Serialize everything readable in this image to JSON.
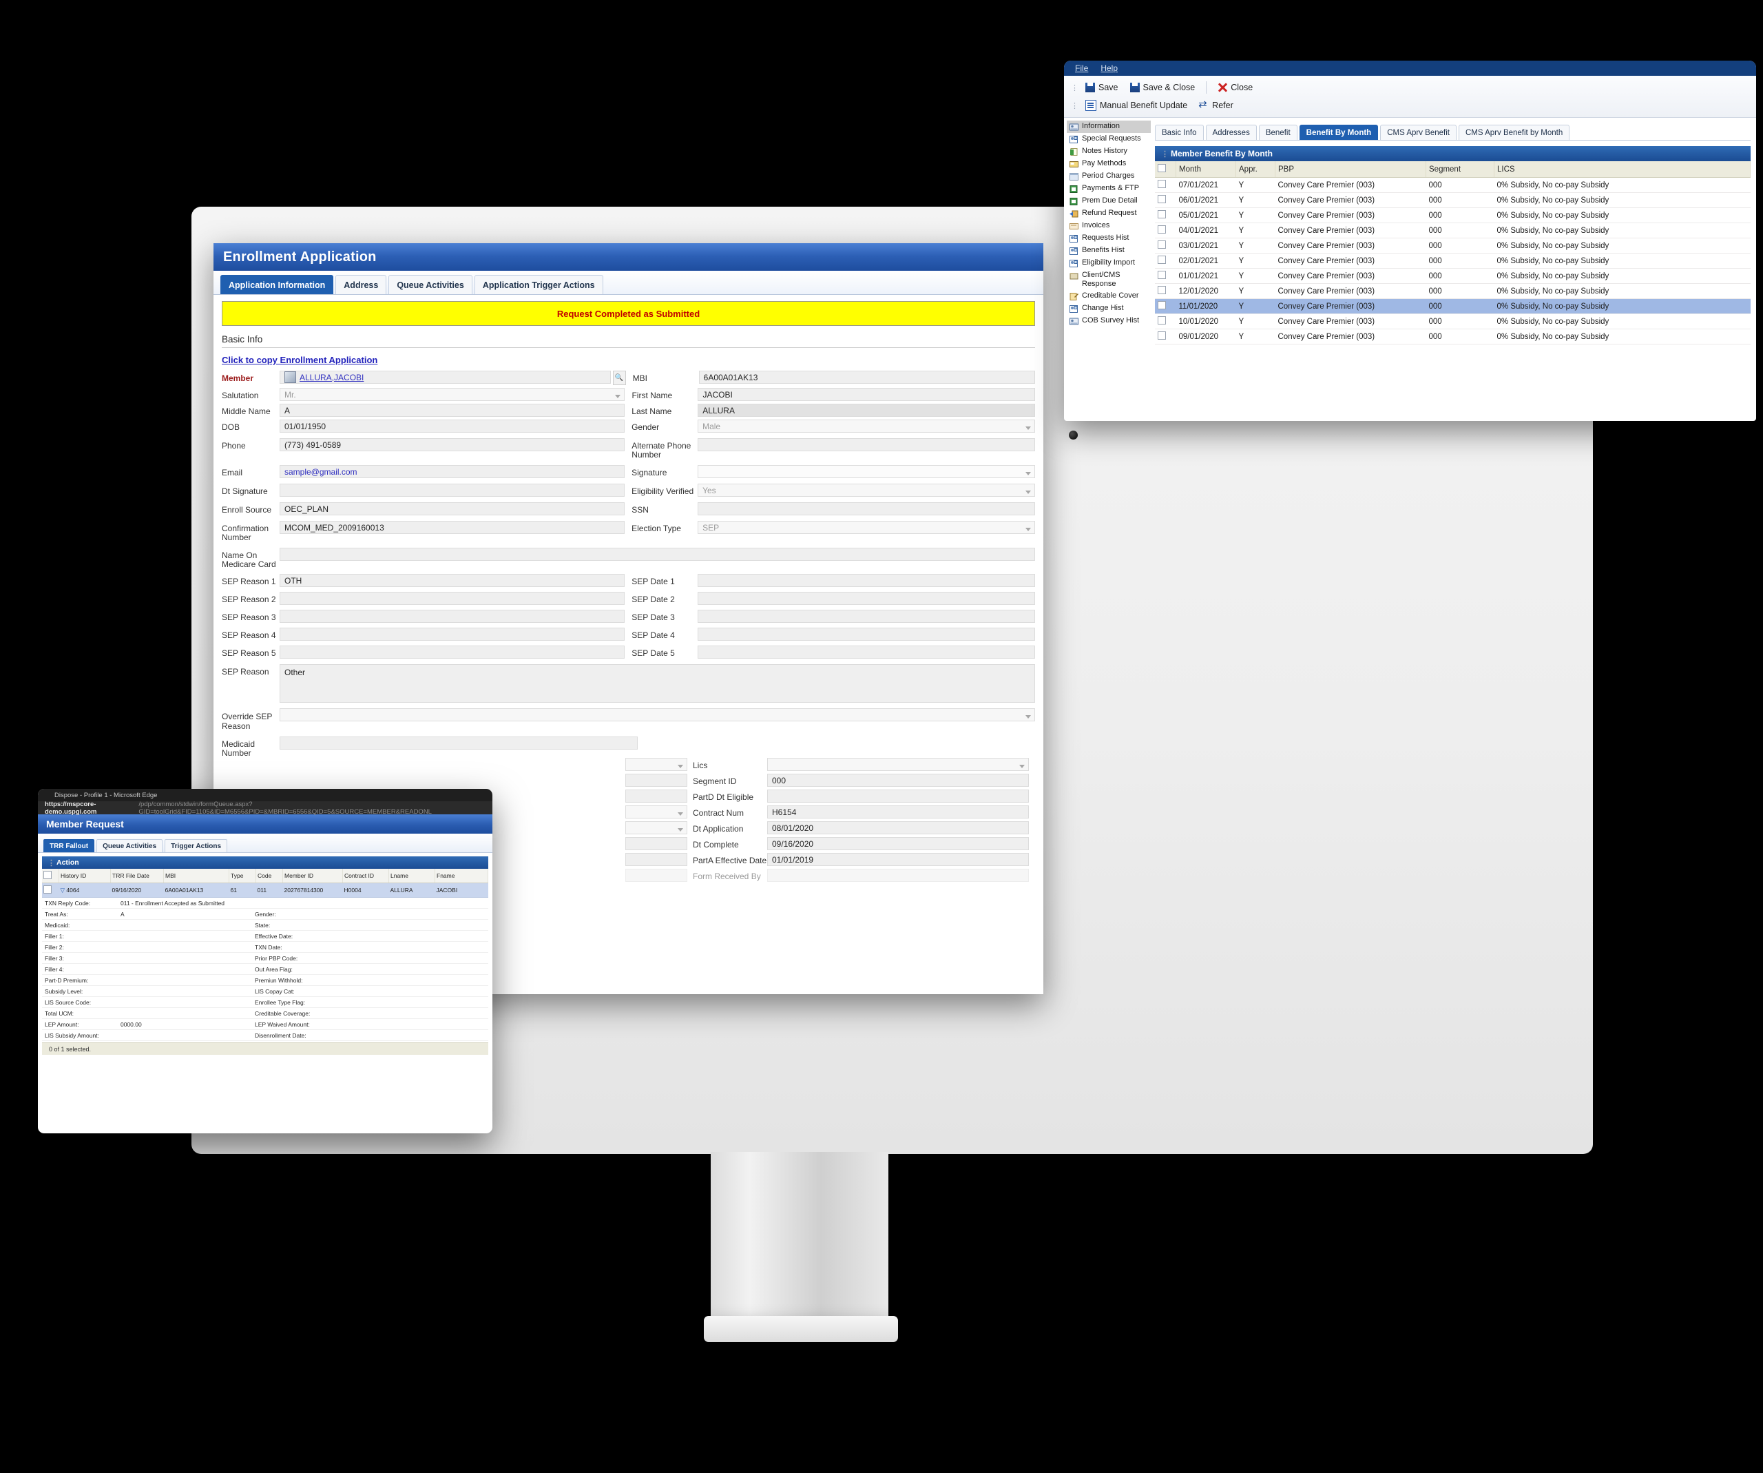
{
  "monitor": {
    "webcam": "webcam-dot"
  },
  "enrollment": {
    "title": "Enrollment Application",
    "tabs": [
      {
        "label": "Application Information",
        "active": true
      },
      {
        "label": "Address",
        "active": false
      },
      {
        "label": "Queue Activities",
        "active": false
      },
      {
        "label": "Application Trigger Actions",
        "active": false
      }
    ],
    "alert": "Request Completed as Submitted",
    "section": "Basic Info",
    "copy_link": "Click to copy Enrollment Application",
    "left_fields": [
      {
        "label": "Member",
        "value": "ALLURA,JACOBI",
        "type": "link",
        "required": true
      },
      {
        "label": "Salutation",
        "value": "Mr.",
        "type": "select-placeholder"
      },
      {
        "label": "Middle Name",
        "value": "A",
        "type": "text"
      },
      {
        "label": "DOB",
        "value": "01/01/1950",
        "type": "text"
      },
      {
        "label": "Phone",
        "value": "(773) 491-0589",
        "type": "text"
      },
      {
        "label": "Email",
        "value": "sample@gmail.com",
        "type": "email"
      },
      {
        "label": "Dt Signature",
        "value": "",
        "type": "text"
      },
      {
        "label": "Enroll Source",
        "value": "OEC_PLAN",
        "type": "text"
      },
      {
        "label": "Confirmation Number",
        "value": "MCOM_MED_2009160013",
        "type": "text"
      }
    ],
    "right_fields": [
      {
        "label": "MBI",
        "value": "6A00A01AK13",
        "type": "text"
      },
      {
        "label": "First Name",
        "value": "JACOBI",
        "type": "text"
      },
      {
        "label": "Last Name",
        "value": "ALLURA",
        "type": "text"
      },
      {
        "label": "Gender",
        "value": "Male",
        "type": "select-placeholder"
      },
      {
        "label": "Alternate Phone Number",
        "value": "",
        "type": "text"
      },
      {
        "label": "Signature",
        "value": "",
        "type": "select"
      },
      {
        "label": "Eligibility Verified",
        "value": "Yes",
        "type": "select-placeholder"
      },
      {
        "label": "SSN",
        "value": "",
        "type": "text"
      },
      {
        "label": "Election Type",
        "value": "SEP",
        "type": "select-placeholder"
      }
    ],
    "name_on_card": {
      "label": "Name On Medicare Card",
      "value": ""
    },
    "sep_rows": [
      {
        "label": "SEP Reason 1",
        "value": "OTH",
        "rlabel": "SEP Date 1",
        "rvalue": ""
      },
      {
        "label": "SEP Reason 2",
        "value": "",
        "rlabel": "SEP Date 2",
        "rvalue": ""
      },
      {
        "label": "SEP Reason 3",
        "value": "",
        "rlabel": "SEP Date 3",
        "rvalue": ""
      },
      {
        "label": "SEP Reason 4",
        "value": "",
        "rlabel": "SEP Date 4",
        "rvalue": ""
      },
      {
        "label": "SEP Reason 5",
        "value": "",
        "rlabel": "SEP Date 5",
        "rvalue": ""
      }
    ],
    "sep_reason": {
      "label": "SEP Reason",
      "value": "Other"
    },
    "override_sep": {
      "label": "Override SEP Reason",
      "value": ""
    },
    "medicaid_number": {
      "label": "Medicaid Number",
      "value": ""
    },
    "lower_right_fields": [
      {
        "label": "Lics",
        "value": "",
        "type": "select"
      },
      {
        "label": "Segment ID",
        "value": "000",
        "type": "text"
      },
      {
        "label": "PartD Dt Eligible",
        "value": "",
        "type": "text"
      },
      {
        "label": "Contract Num",
        "value": "H6154",
        "type": "text"
      },
      {
        "label": "Dt Application",
        "value": "08/01/2020",
        "type": "text"
      },
      {
        "label": "Dt Complete",
        "value": "09/16/2020",
        "type": "text"
      },
      {
        "label": "PartA Effective Date",
        "value": "01/01/2019",
        "type": "text"
      },
      {
        "label": "Form Received By",
        "value": "",
        "type": "text"
      }
    ]
  },
  "benefit_window": {
    "menu": [
      "File",
      "Help"
    ],
    "toolbar_row1": [
      {
        "label": "Save",
        "icon": "save-icon"
      },
      {
        "label": "Save & Close",
        "icon": "save-close-icon"
      },
      {
        "label": "Close",
        "icon": "close-icon"
      }
    ],
    "toolbar_row2": [
      {
        "label": "Manual Benefit Update",
        "icon": "manual-benefit-update-icon"
      },
      {
        "label": "Refer",
        "icon": "refer-icon"
      }
    ],
    "sidebar": [
      {
        "label": "Information",
        "active": true
      },
      {
        "label": "Special Requests",
        "active": false
      },
      {
        "label": "Notes History",
        "active": false
      },
      {
        "label": "Pay Methods",
        "active": false
      },
      {
        "label": "Period Charges",
        "active": false
      },
      {
        "label": "Payments & FTP",
        "active": false
      },
      {
        "label": "Prem Due Detail",
        "active": false
      },
      {
        "label": "Refund Request",
        "active": false
      },
      {
        "label": "Invoices",
        "active": false
      },
      {
        "label": "Requests Hist",
        "active": false
      },
      {
        "label": "Benefits Hist",
        "active": false
      },
      {
        "label": "Eligibility Import",
        "active": false
      },
      {
        "label": "Client/CMS Response",
        "active": false
      },
      {
        "label": "Creditable Cover",
        "active": false
      },
      {
        "label": "Change Hist",
        "active": false
      },
      {
        "label": "COB Survey Hist",
        "active": false
      }
    ],
    "tabs": [
      {
        "label": "Basic Info",
        "active": false
      },
      {
        "label": "Addresses",
        "active": false
      },
      {
        "label": "Benefit",
        "active": false
      },
      {
        "label": "Benefit By Month",
        "active": true
      },
      {
        "label": "CMS Aprv Benefit",
        "active": false
      },
      {
        "label": "CMS Aprv Benefit by Month",
        "active": false
      }
    ],
    "grid_title": "Member Benefit By Month",
    "columns": [
      "Month",
      "Appr.",
      "PBP",
      "Segment",
      "LICS"
    ],
    "rows": [
      {
        "month": "07/01/2021",
        "appr": "Y",
        "pbp": "Convey Care Premier (003)",
        "segment": "000",
        "lics": "0% Subsidy, No co-pay Subsidy",
        "selected": false
      },
      {
        "month": "06/01/2021",
        "appr": "Y",
        "pbp": "Convey Care Premier (003)",
        "segment": "000",
        "lics": "0% Subsidy, No co-pay Subsidy",
        "selected": false
      },
      {
        "month": "05/01/2021",
        "appr": "Y",
        "pbp": "Convey Care Premier (003)",
        "segment": "000",
        "lics": "0% Subsidy, No co-pay Subsidy",
        "selected": false
      },
      {
        "month": "04/01/2021",
        "appr": "Y",
        "pbp": "Convey Care Premier (003)",
        "segment": "000",
        "lics": "0% Subsidy, No co-pay Subsidy",
        "selected": false
      },
      {
        "month": "03/01/2021",
        "appr": "Y",
        "pbp": "Convey Care Premier (003)",
        "segment": "000",
        "lics": "0% Subsidy, No co-pay Subsidy",
        "selected": false
      },
      {
        "month": "02/01/2021",
        "appr": "Y",
        "pbp": "Convey Care Premier (003)",
        "segment": "000",
        "lics": "0% Subsidy, No co-pay Subsidy",
        "selected": false
      },
      {
        "month": "01/01/2021",
        "appr": "Y",
        "pbp": "Convey Care Premier (003)",
        "segment": "000",
        "lics": "0% Subsidy, No co-pay Subsidy",
        "selected": false
      },
      {
        "month": "12/01/2020",
        "appr": "Y",
        "pbp": "Convey Care Premier (003)",
        "segment": "000",
        "lics": "0% Subsidy, No co-pay Subsidy",
        "selected": false
      },
      {
        "month": "11/01/2020",
        "appr": "Y",
        "pbp": "Convey Care Premier (003)",
        "segment": "000",
        "lics": "0% Subsidy, No co-pay Subsidy",
        "selected": true
      },
      {
        "month": "10/01/2020",
        "appr": "Y",
        "pbp": "Convey Care Premier (003)",
        "segment": "000",
        "lics": "0% Subsidy, No co-pay Subsidy",
        "selected": false
      },
      {
        "month": "09/01/2020",
        "appr": "Y",
        "pbp": "Convey Care Premier (003)",
        "segment": "000",
        "lics": "0% Subsidy, No co-pay Subsidy",
        "selected": false
      }
    ]
  },
  "member_request": {
    "browser_title": "Dispose - Profile 1 - Microsoft Edge",
    "url_host": "https://mspcore-demo.uspgi.com",
    "url_path": "/pdp/common/stdwin/formQueue.aspx?GID=toolGrid&FID=1105&ID=M6556&PID=&MBRID=6556&QID=5&SOURCE=MEMBER&READONL",
    "title": "Member Request",
    "tabs": [
      {
        "label": "TRR Fallout",
        "active": true
      },
      {
        "label": "Queue Activities",
        "active": false
      },
      {
        "label": "Trigger Actions",
        "active": false
      }
    ],
    "action_header": "Action",
    "columns": [
      "History ID",
      "TRR File Date",
      "MBI",
      "Type",
      "Code",
      "Member ID",
      "Contract ID",
      "Lname",
      "Fname"
    ],
    "row": {
      "history_id": "4064",
      "trr_file_date": "09/16/2020",
      "mbi": "6A00A01AK13",
      "type": "61",
      "code": "011",
      "member_id": "202767814300",
      "contract_id": "H0004",
      "lname": "ALLURA",
      "fname": "JACOBI"
    },
    "details": [
      {
        "k": "TXN Reply Code:",
        "v": "011 - Enrollment Accepted as Submitted",
        "k2": "",
        "v2": ""
      },
      {
        "k": "Treat As:",
        "v": "A",
        "k2": "Gender:",
        "v2": ""
      },
      {
        "k": "Medicaid:",
        "v": "",
        "k2": "State:",
        "v2": ""
      },
      {
        "k": "Filler 1:",
        "v": "",
        "k2": "Effective Date:",
        "v2": ""
      },
      {
        "k": "Filler 2:",
        "v": "",
        "k2": "TXN Date:",
        "v2": ""
      },
      {
        "k": "Filler 3:",
        "v": "",
        "k2": "Prior PBP Code:",
        "v2": ""
      },
      {
        "k": "Filler 4:",
        "v": "",
        "k2": "Out Area Flag:",
        "v2": ""
      },
      {
        "k": "Part-D Premium:",
        "v": "",
        "k2": "Premiun Withhold:",
        "v2": ""
      },
      {
        "k": "Subsidy Level:",
        "v": "",
        "k2": "LIS Copay Cat:",
        "v2": ""
      },
      {
        "k": "LIS Source Code:",
        "v": "",
        "k2": "Enrollee Type Flag:",
        "v2": ""
      },
      {
        "k": "Total UCM:",
        "v": "",
        "k2": "Creditable Coverage:",
        "v2": ""
      },
      {
        "k": "LEP Amount:",
        "v": "0000.00",
        "k2": "LEP Waived Amount:",
        "v2": ""
      },
      {
        "k": "LIS Subsidy Amount:",
        "v": "",
        "k2": "Disenrollment Date:",
        "v2": ""
      }
    ],
    "status": "0 of 1 selected."
  },
  "colors": {
    "title_blue": "#1d4d9e",
    "tab_active": "#1f5fb0",
    "alert_yellow": "#ffff00",
    "alert_text": "#c00000",
    "grid_header": "#ecebdd",
    "row_selected": "#9fb8e4"
  }
}
